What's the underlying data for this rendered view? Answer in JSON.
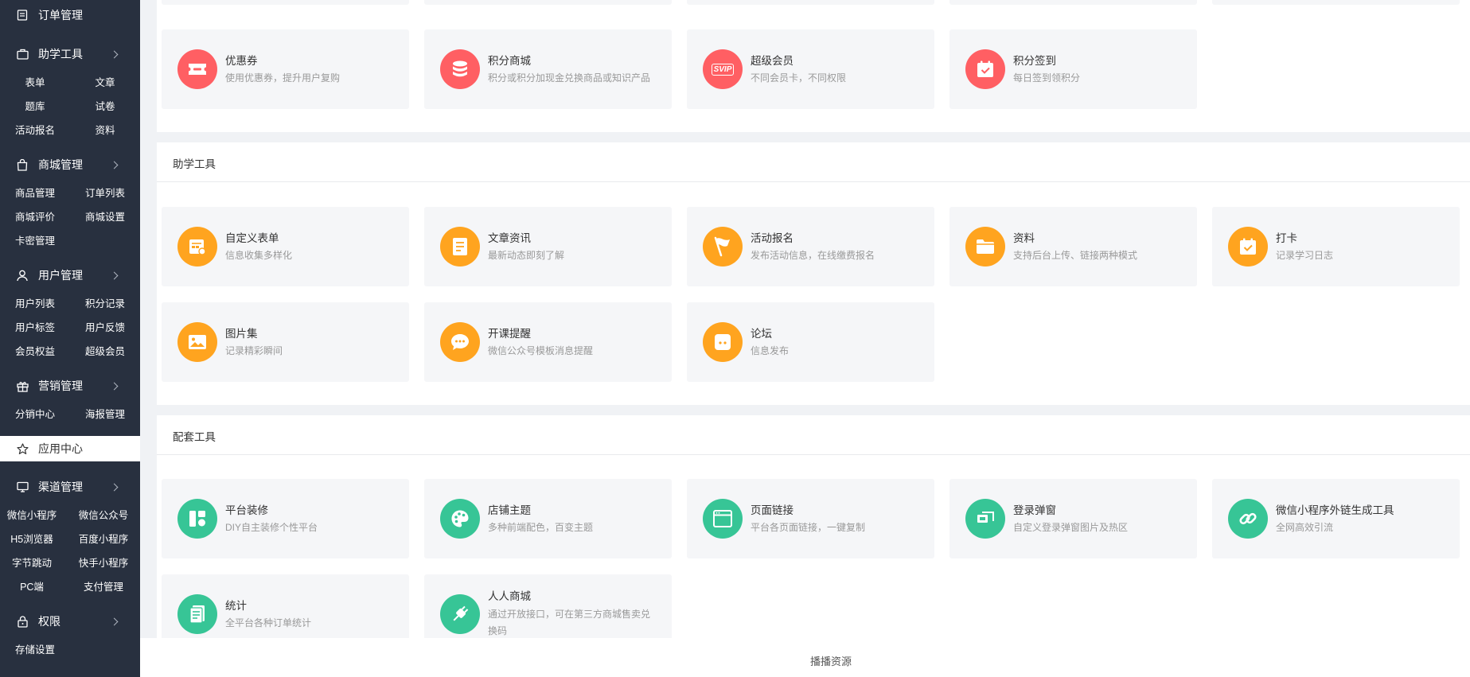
{
  "sidebar": {
    "order": {
      "label": "订单管理",
      "icon": "list-icon"
    },
    "study": {
      "label": "助学工具",
      "icon": "bag-icon",
      "items": [
        "表单",
        "文章",
        "题库",
        "试卷",
        "活动报名",
        "资料"
      ]
    },
    "mall": {
      "label": "商城管理",
      "icon": "shopping-bag-icon",
      "items": [
        "商品管理",
        "订单列表",
        "商城评价",
        "商城设置",
        "卡密管理"
      ]
    },
    "user": {
      "label": "用户管理",
      "icon": "user-icon",
      "items": [
        "用户列表",
        "积分记录",
        "用户标签",
        "用户反馈",
        "会员权益",
        "超级会员"
      ]
    },
    "marketing": {
      "label": "营销管理",
      "icon": "gift-icon",
      "items": [
        "分销中心",
        "海报管理"
      ]
    },
    "app_center": {
      "label": "应用中心",
      "icon": "star-icon"
    },
    "channel": {
      "label": "渠道管理",
      "icon": "monitor-icon",
      "items": [
        "微信小程序",
        "微信公众号",
        "H5浏览器",
        "百度小程序",
        "字节跳动",
        "快手小程序",
        "PC端",
        "支付管理"
      ]
    },
    "permission": {
      "label": "权限",
      "icon": "lock-icon"
    },
    "storage": {
      "label": "存储设置"
    }
  },
  "sections": {
    "marketing_row": [
      {
        "title": "优惠券",
        "desc": "使用优惠券，提升用户复购",
        "icon": "ticket-icon",
        "color": "#ff5f63"
      },
      {
        "title": "积分商城",
        "desc": "积分或积分加现金兑换商品或知识产品",
        "icon": "coins-icon",
        "color": "#ff5f63"
      },
      {
        "title": "超级会员",
        "desc": "不同会员卡，不同权限",
        "icon": "svip-icon",
        "icon_text": "SVIP",
        "color": "#ff5f63"
      },
      {
        "title": "积分签到",
        "desc": "每日签到领积分",
        "icon": "calendar-check-icon",
        "color": "#ff5f63"
      }
    ],
    "study_tools": {
      "title": "助学工具",
      "cards": [
        {
          "title": "自定义表单",
          "desc": "信息收集多样化",
          "icon": "form-icon"
        },
        {
          "title": "文章资讯",
          "desc": "最新动态即刻了解",
          "icon": "article-icon"
        },
        {
          "title": "活动报名",
          "desc": "发布活动信息，在线缴费报名",
          "icon": "flag-icon"
        },
        {
          "title": "资料",
          "desc": "支持后台上传、链接两种模式",
          "icon": "folder-icon"
        },
        {
          "title": "打卡",
          "desc": "记录学习日志",
          "icon": "calendar-check-icon"
        },
        {
          "title": "图片集",
          "desc": "记录精彩瞬间",
          "icon": "image-icon"
        },
        {
          "title": "开课提醒",
          "desc": "微信公众号模板消息提醒",
          "icon": "chat-bubble-icon"
        },
        {
          "title": "论坛",
          "desc": "信息发布",
          "icon": "forum-icon"
        }
      ],
      "color": "#ffa41f"
    },
    "support_tools": {
      "title": "配套工具",
      "cards": [
        {
          "title": "平台装修",
          "desc": "DIY自主装修个性平台",
          "icon": "layout-icon"
        },
        {
          "title": "店铺主题",
          "desc": "多种前端配色，百变主题",
          "icon": "palette-icon"
        },
        {
          "title": "页面链接",
          "desc": "平台各页面链接，一键复制",
          "icon": "browser-window-icon"
        },
        {
          "title": "登录弹窗",
          "desc": "自定义登录弹窗图片及热区",
          "icon": "popup-icon"
        },
        {
          "title": "微信小程序外链生成工具",
          "desc": "全网高效引流",
          "icon": "link-icon"
        },
        {
          "title": "统计",
          "desc": "全平台各种订单统计",
          "icon": "report-icon"
        },
        {
          "title": "人人商城",
          "desc": "通过开放接口，可在第三方商城售卖兑换码",
          "icon": "plug-icon"
        }
      ],
      "color": "#37c596"
    }
  },
  "footer": {
    "text": "播播资源"
  }
}
